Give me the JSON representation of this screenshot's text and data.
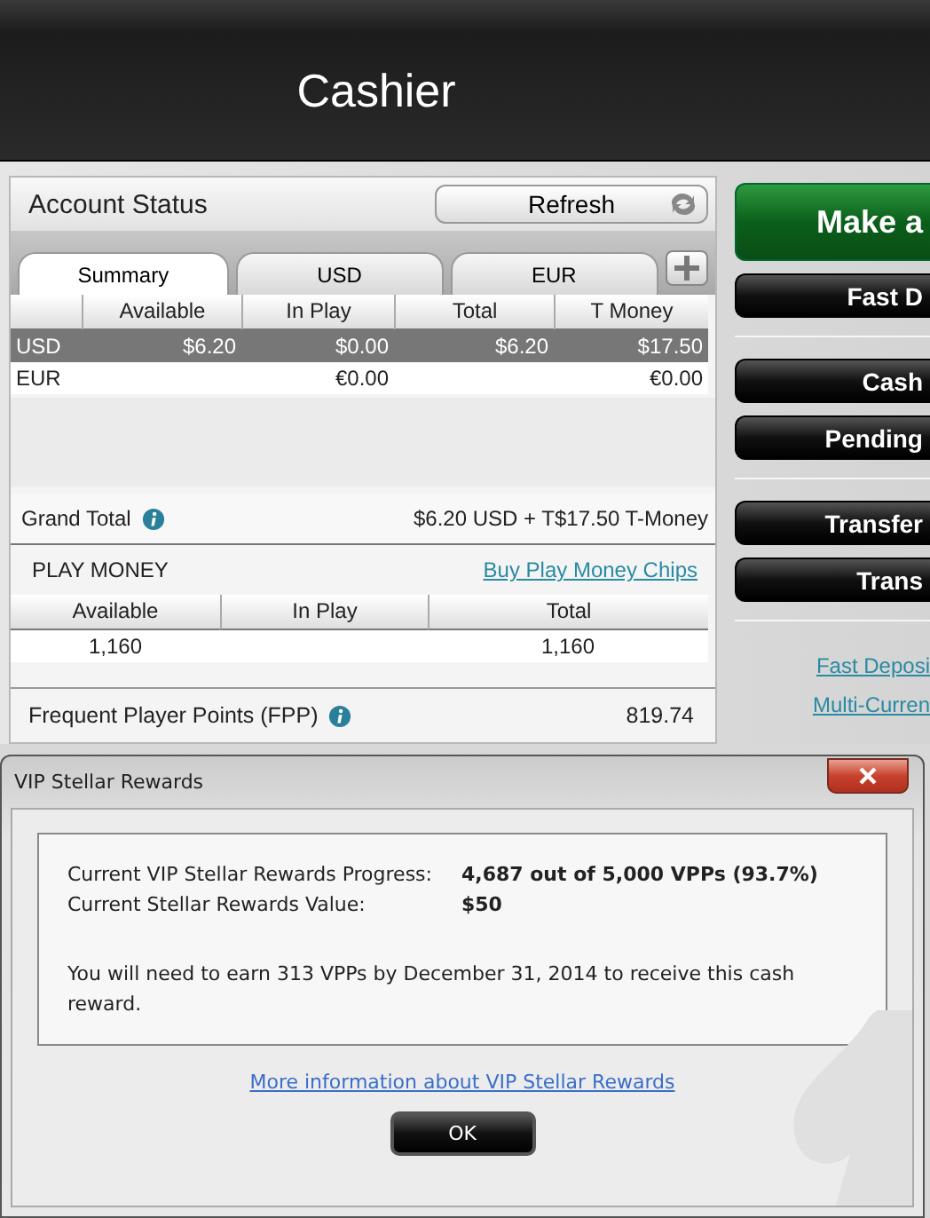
{
  "window": {
    "title": "Cashier"
  },
  "account_status": {
    "title": "Account Status",
    "refresh_button": "Refresh",
    "tabs": [
      {
        "label": "Summary",
        "selected": true
      },
      {
        "label": "USD",
        "selected": false
      },
      {
        "label": "EUR",
        "selected": false
      }
    ],
    "columns": [
      "Available",
      "In Play",
      "Total",
      "T Money"
    ],
    "rows": [
      {
        "currency": "USD",
        "available": "$6.20",
        "in_play": "$0.00",
        "total": "$6.20",
        "t_money": "$17.50",
        "selected": true
      },
      {
        "currency": "EUR",
        "in_play": "€0.00",
        "t_money": "€0.00",
        "selected": false
      }
    ],
    "grand_total": {
      "label": "Grand Total",
      "value": "$6.20 USD + T$17.50 T-Money"
    }
  },
  "play_money": {
    "title": "PLAY MONEY",
    "link": "Buy Play Money Chips",
    "columns": [
      "Available",
      "In Play",
      "Total"
    ],
    "row": {
      "available": "1,160",
      "total": "1,160"
    }
  },
  "fpp": {
    "label": "Frequent Player Points (FPP)",
    "value": "819.74"
  },
  "side_button_groups": [
    [
      {
        "label": "Make a",
        "kind": "primary"
      },
      {
        "label": "Fast D",
        "kind": "dark"
      }
    ],
    [
      {
        "label": "Cash",
        "kind": "dark"
      },
      {
        "label": "Pending",
        "kind": "dark"
      }
    ],
    [
      {
        "label": "Transfer",
        "kind": "dark"
      },
      {
        "label": "Trans",
        "kind": "dark"
      }
    ]
  ],
  "side_links": [
    "Fast Deposi",
    "Multi-Curren"
  ],
  "dialog": {
    "title": "VIP Stellar Rewards",
    "details": [
      {
        "label": "Current VIP Stellar Rewards Progress:",
        "value": "4,687 out of 5,000 VPPs (93.7%)"
      },
      {
        "label": "Current Stellar Rewards Value:",
        "value": "$50"
      }
    ],
    "message": "You will need to earn 313 VPPs by December 31, 2014 to receive this cash reward.",
    "link": "More information about VIP Stellar Rewards",
    "ok_button": "OK"
  }
}
